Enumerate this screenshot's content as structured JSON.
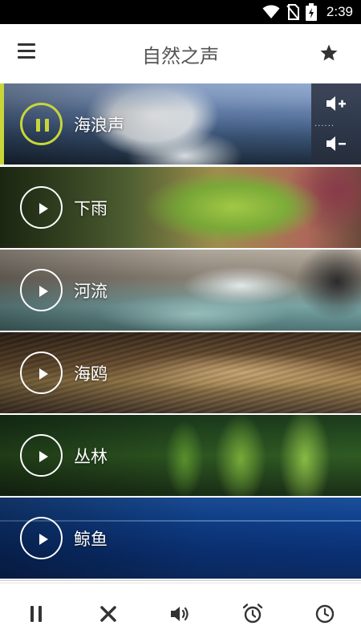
{
  "status_bar": {
    "time": "2:39"
  },
  "app_bar": {
    "title": "自然之声"
  },
  "colors": {
    "accent": "#c8d63a",
    "text_dark": "#333333"
  },
  "sounds": [
    {
      "label": "海浪声",
      "state": "playing"
    },
    {
      "label": "下雨",
      "state": "stopped"
    },
    {
      "label": "河流",
      "state": "stopped"
    },
    {
      "label": "海鸥",
      "state": "stopped"
    },
    {
      "label": "丛林",
      "state": "stopped"
    },
    {
      "label": "鲸鱼",
      "state": "stopped"
    }
  ],
  "bottom_bar": {
    "icons": [
      "pause-icon",
      "close-icon",
      "volume-icon",
      "alarm-clock-icon",
      "clock-icon"
    ]
  }
}
